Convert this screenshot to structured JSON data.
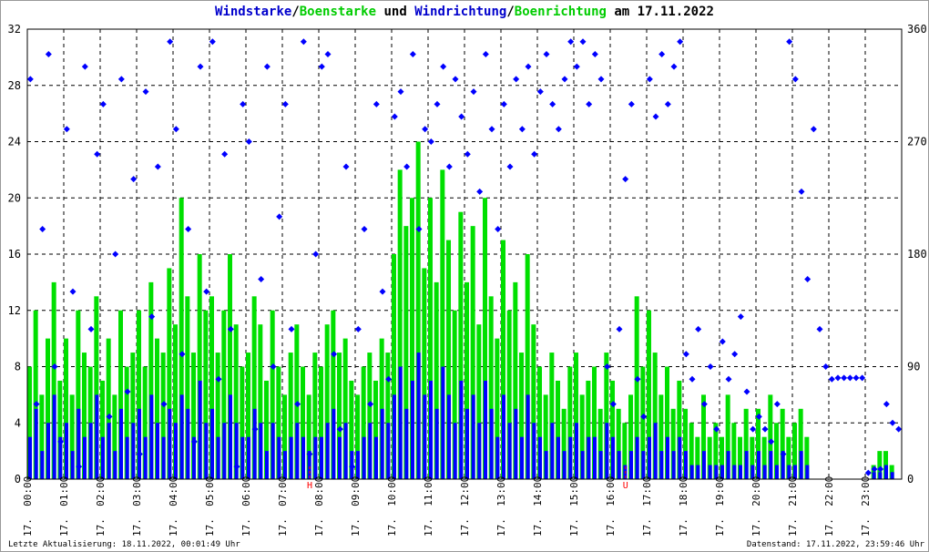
{
  "title": {
    "part1": "Windstarke",
    "sep1": "/",
    "part2": "Boenstarke",
    "part3": " und ",
    "part4": "Windrichtung",
    "sep2": "/",
    "part5": "Boenrichtung",
    "part6": " am 17.11.2022"
  },
  "footer": {
    "last_update": "Letzte Aktualisierung: 18.11.2022, 00:01:49 Uhr",
    "data_state": "Datenstand: 17.11.2022, 23:59:46 Uhr"
  },
  "colors": {
    "wind": "#0000ff",
    "gust": "#00e000",
    "grid": "#000000",
    "marker": "#ff0000"
  },
  "chart_data": {
    "type": "bar+scatter",
    "title": "Windstarke/Boenstarke und Windrichtung/Boenrichtung am 17.11.2022",
    "x_tick_labels": [
      "17. 00:00",
      "17. 01:00",
      "17. 02:00",
      "17. 03:00",
      "17. 04:00",
      "17. 05:00",
      "17. 06:00",
      "17. 07:00",
      "17. 08:00",
      "17. 09:00",
      "17. 10:00",
      "17. 11:00",
      "17. 12:00",
      "17. 13:00",
      "17. 14:00",
      "17. 15:00",
      "17. 16:00",
      "17. 17:00",
      "17. 18:00",
      "17. 19:00",
      "17. 20:00",
      "17. 21:00",
      "17. 22:00",
      "17. 23:00"
    ],
    "y_left_ticks": [
      "0",
      "4",
      "8",
      "12",
      "16",
      "20",
      "24",
      "28",
      "32"
    ],
    "y_left_range": [
      0,
      32
    ],
    "y_right_ticks": [
      "0",
      "90",
      "180",
      "270",
      "360"
    ],
    "y_right_range": [
      0,
      360
    ],
    "x_range_hours": [
      0,
      24
    ],
    "sample_interval_min": 10,
    "markers": [
      {
        "label": "H",
        "hour": 7.75
      },
      {
        "label": "U",
        "hour": 16.42
      }
    ],
    "series": [
      {
        "name": "Boenstarke",
        "values": [
          8,
          12,
          6,
          10,
          14,
          7,
          10,
          6,
          12,
          9,
          8,
          13,
          7,
          10,
          6,
          12,
          8,
          9,
          12,
          8,
          14,
          10,
          9,
          15,
          11,
          20,
          13,
          9,
          16,
          12,
          13,
          9,
          12,
          16,
          11,
          8,
          9,
          13,
          11,
          7,
          12,
          8,
          6,
          9,
          11,
          8,
          6,
          9,
          8,
          11,
          12,
          9,
          10,
          7,
          6,
          8,
          9,
          7,
          10,
          9,
          16,
          22,
          18,
          20,
          24,
          15,
          20,
          14,
          22,
          17,
          12,
          19,
          14,
          18,
          11,
          20,
          13,
          10,
          17,
          12,
          14,
          9,
          16,
          11,
          8,
          6,
          9,
          7,
          5,
          8,
          9,
          6,
          7,
          8,
          5,
          9,
          7,
          5,
          4,
          6,
          13,
          8,
          12,
          9,
          6,
          8,
          5,
          7,
          5,
          4,
          3,
          6,
          3,
          4,
          3,
          6,
          4,
          3,
          5,
          3,
          5,
          3,
          6,
          4,
          5,
          3,
          4,
          5,
          3,
          0,
          0,
          0,
          0,
          0,
          0,
          0,
          0,
          0,
          0,
          1,
          2,
          2,
          1,
          0
        ]
      },
      {
        "name": "Windstarke",
        "values": [
          3,
          5,
          2,
          4,
          6,
          3,
          4,
          2,
          5,
          3,
          4,
          6,
          3,
          4,
          2,
          5,
          3,
          4,
          5,
          3,
          6,
          4,
          3,
          5,
          4,
          6,
          5,
          3,
          7,
          4,
          5,
          3,
          4,
          6,
          4,
          3,
          3,
          5,
          4,
          2,
          4,
          3,
          2,
          3,
          4,
          3,
          2,
          3,
          3,
          4,
          5,
          3,
          4,
          2,
          2,
          3,
          4,
          3,
          5,
          4,
          6,
          8,
          5,
          7,
          9,
          6,
          7,
          5,
          8,
          6,
          4,
          7,
          5,
          6,
          4,
          7,
          5,
          3,
          6,
          4,
          5,
          3,
          6,
          4,
          3,
          2,
          4,
          3,
          2,
          3,
          4,
          2,
          3,
          3,
          2,
          4,
          3,
          2,
          1,
          2,
          3,
          2,
          3,
          4,
          2,
          3,
          2,
          3,
          2,
          1,
          1,
          2,
          1,
          1,
          1,
          2,
          1,
          1,
          2,
          1,
          2,
          1,
          2,
          1,
          2,
          1,
          1,
          2,
          1,
          0,
          0,
          0,
          0,
          0,
          0,
          0,
          0,
          0,
          0,
          0.5,
          0.5,
          1,
          0.5,
          0
        ]
      },
      {
        "name": "Windrichtung",
        "unit": "deg",
        "values": [
          320,
          60,
          200,
          340,
          90,
          30,
          280,
          150,
          10,
          330,
          120,
          260,
          300,
          50,
          180,
          320,
          70,
          240,
          20,
          310,
          130,
          250,
          60,
          350,
          280,
          100,
          200,
          30,
          330,
          150,
          350,
          80,
          260,
          120,
          10,
          300,
          270,
          40,
          160,
          330,
          90,
          210,
          300,
          120,
          60,
          350,
          20,
          180,
          330,
          340,
          100,
          40,
          250,
          10,
          120,
          200,
          60,
          300,
          150,
          80,
          290,
          310,
          250,
          340,
          200,
          280,
          270,
          300,
          330,
          250,
          320,
          290,
          260,
          310,
          230,
          340,
          280,
          200,
          300,
          250,
          320,
          280,
          330,
          260,
          310,
          340,
          300,
          280,
          320,
          350,
          330,
          350,
          300,
          340,
          320,
          90,
          60,
          120,
          240,
          300,
          80,
          50,
          320,
          290,
          340,
          300,
          330,
          350,
          100,
          80,
          120,
          60,
          90,
          40,
          110,
          80,
          100,
          130,
          70,
          40,
          50,
          40,
          30,
          60,
          20,
          350,
          320,
          230,
          160,
          280,
          120,
          90,
          80,
          81,
          81,
          81,
          81,
          81,
          5,
          8,
          8,
          60,
          45,
          40
        ]
      }
    ]
  }
}
